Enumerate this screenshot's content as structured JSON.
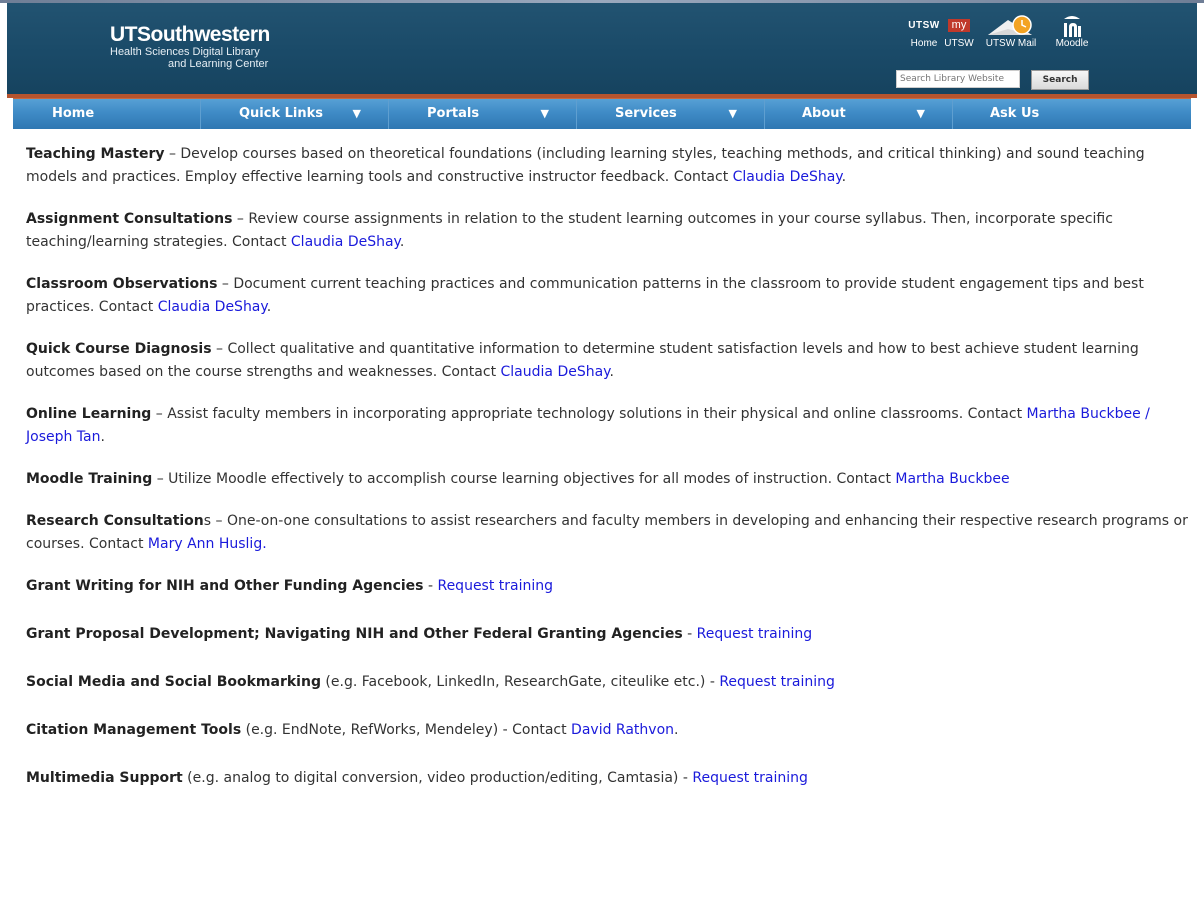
{
  "brand": {
    "title": "UTSouthwestern",
    "sub1": "Health Sciences Digital Library",
    "sub2": "and Learning Center"
  },
  "quick_links": [
    {
      "label": "Home",
      "icon": "UTSW"
    },
    {
      "label": "UTSW",
      "icon": "my"
    },
    {
      "label": "UTSW Mail",
      "icon": "mail-icon"
    },
    {
      "label": "Moodle",
      "icon": "moodle-icon"
    }
  ],
  "search": {
    "placeholder": "Search Library Website",
    "button": "Search"
  },
  "nav": [
    {
      "label": "Home",
      "caret": ""
    },
    {
      "label": "Quick Links",
      "caret": "▼"
    },
    {
      "label": "Portals",
      "caret": "▼"
    },
    {
      "label": "Services",
      "caret": "▼"
    },
    {
      "label": "About",
      "caret": "▼"
    },
    {
      "label": "Ask Us",
      "caret": ""
    }
  ],
  "items": [
    {
      "title": "Teaching Mastery",
      "text": " – Develop courses based on theoretical foundations (including learning styles, teaching methods, and critical thinking) and sound teaching models and practices. Employ effective learning tools and constructive instructor feedback. Contact ",
      "link": "Claudia DeShay",
      "after": "."
    },
    {
      "title": "Assignment Consultations",
      "text": " – Review course assignments in relation to the student learning outcomes in your course syllabus. Then, incorporate specific teaching/learning strategies. Contact ",
      "link": "Claudia DeShay",
      "after": "."
    },
    {
      "title": "Classroom Observations",
      "text": " – Document current teaching practices and communication patterns in the classroom to provide student engagement tips and best practices. Contact ",
      "link": "Claudia DeShay",
      "after": "."
    },
    {
      "title": "Quick Course Diagnosis",
      "text": " – Collect qualitative and quantitative information to determine student satisfaction levels and how to best achieve student learning outcomes based on the course strengths and weaknesses. Contact ",
      "link": "Claudia DeShay",
      "after": "."
    },
    {
      "title": "Online Learning",
      "text": " – Assist faculty members in incorporating appropriate technology solutions in their physical and online classrooms. Contact ",
      "link": "Martha Buckbee / Joseph Tan",
      "after": "."
    },
    {
      "title": "Moodle Training",
      "text": " – Utilize Moodle effectively to accomplish course learning objectives for all modes of instruction. Contact ",
      "link": "Martha Buckbee",
      "after": ""
    },
    {
      "title": "Research Consultation",
      "text": "s – One-on-one consultations to assist researchers and faculty members in developing and enhancing their respective research programs or courses. Contact ",
      "link": "Mary Ann Huslig.",
      "after": ""
    },
    {
      "title": "Grant Writing for NIH and Other Funding Agencies",
      "text": " - ",
      "link": "Request training",
      "after": ""
    },
    {
      "title": "Grant Proposal Development; Navigating NIH and Other Federal Granting Agencies",
      "text": " - ",
      "link": "Request training",
      "after": ""
    },
    {
      "title": "Social Media and Social Bookmarking",
      "text": " (e.g. Facebook, LinkedIn, ResearchGate, citeulike etc.) - ",
      "link": "Request training",
      "after": ""
    },
    {
      "title": "Citation Management Tools",
      "text": " (e.g. EndNote, RefWorks, Mendeley) - Contact ",
      "link": "David Rathvon",
      "after": "."
    },
    {
      "title": "Multimedia Support",
      "text": " (e.g. analog to digital conversion, video production/editing, Camtasia) - ",
      "link": "Request training",
      "after": ""
    }
  ]
}
